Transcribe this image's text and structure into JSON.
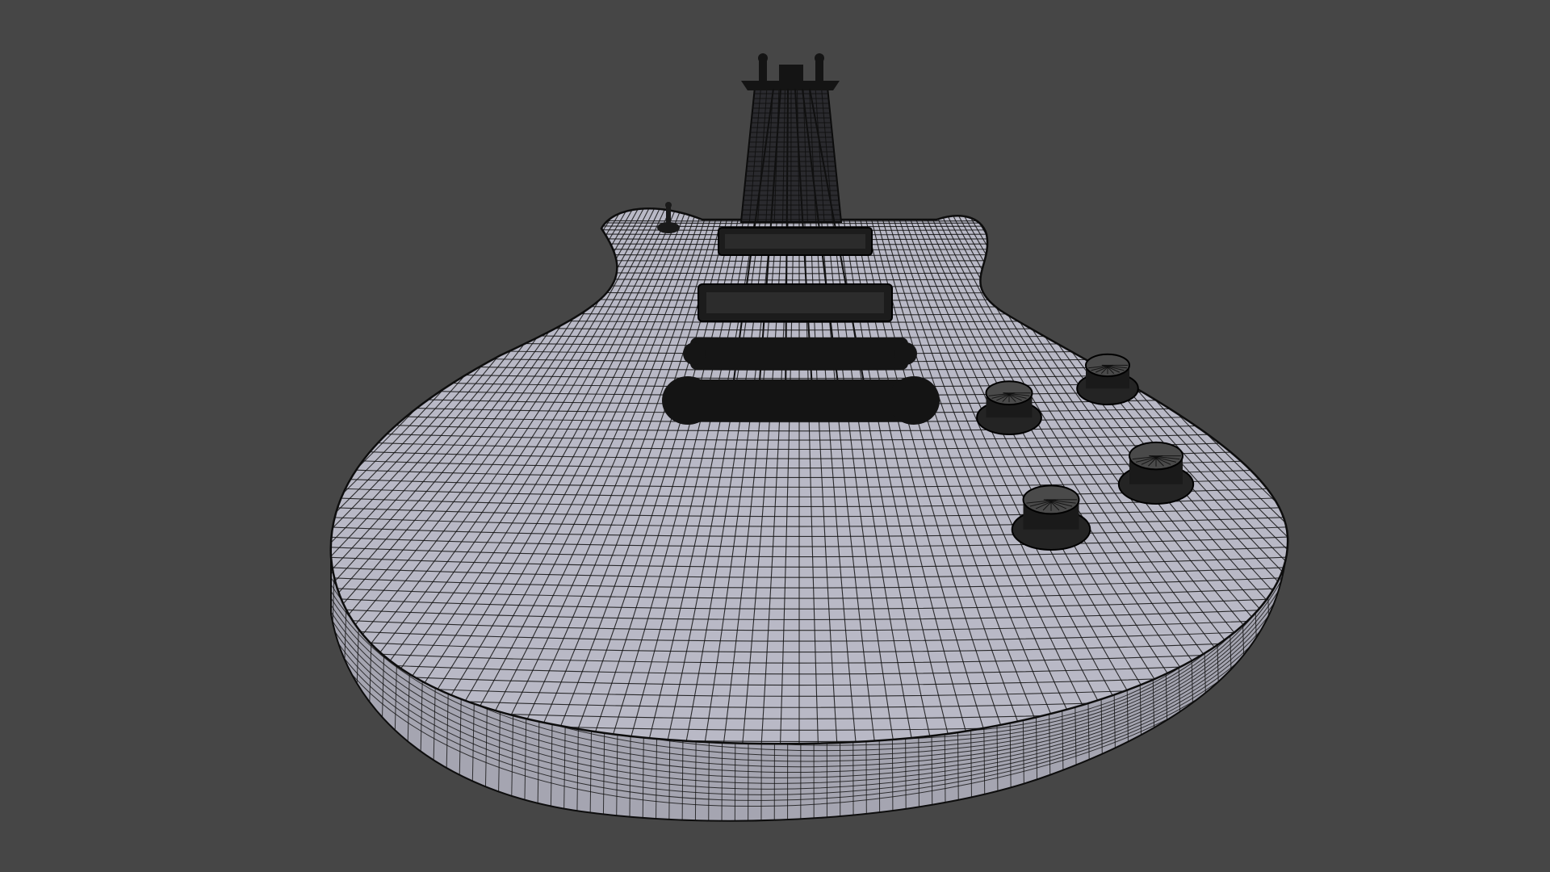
{
  "viewport": {
    "background_color": "#464646"
  },
  "model": {
    "subject": "electric-guitar-wireframe",
    "shading": "wireframe-on-shaded",
    "surface_color": "#b9b9c6",
    "side_color": "#a7a7b3",
    "wire_color": "#101010",
    "hardware_color": "#161616",
    "knob_count": 4,
    "pickup_count": 2
  }
}
